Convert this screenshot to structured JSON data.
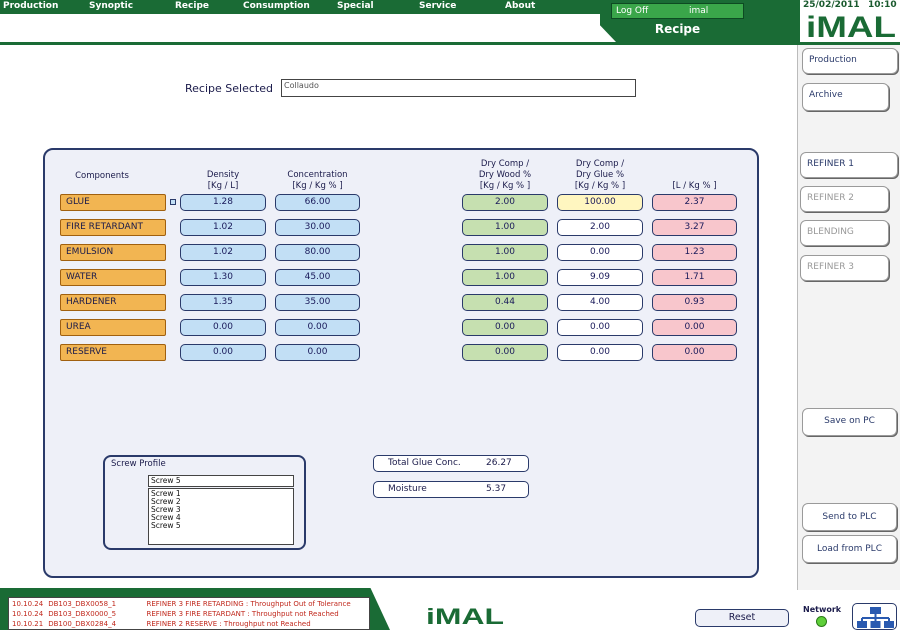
{
  "menu": [
    "Production",
    "Synoptic",
    "Recipe",
    "Consumption",
    "Special",
    "Service",
    "About"
  ],
  "header": {
    "logoff_label": "Log Off",
    "user": "imal",
    "date": "25/02/2011",
    "time": "10:10",
    "page_title": "Recipe",
    "logo_text": "iMAL"
  },
  "sidebar": {
    "top": [
      "Production",
      "Archive"
    ],
    "refiners": [
      "REFINER 1",
      "REFINER 2",
      "BLENDING",
      "REFINER 3"
    ],
    "save_pc": "Save on PC",
    "send_plc": "Send to PLC",
    "load_plc": "Load from PLC"
  },
  "recipe": {
    "label": "Recipe Selected",
    "value": "Collaudo"
  },
  "table": {
    "headers": {
      "components": "Components",
      "density": [
        "Density",
        "[Kg / L]"
      ],
      "concentration": [
        "Concentration",
        "[Kg / Kg % ]"
      ],
      "dry_wood": [
        "Dry Comp /",
        "Dry Wood %",
        "[Kg / Kg % ]"
      ],
      "dry_glue": [
        "Dry Comp /",
        "Dry Glue %",
        "[Kg / Kg % ]"
      ],
      "l_kg": [
        "[L / Kg % ]"
      ]
    },
    "rows": [
      {
        "name": "GLUE",
        "density": "1.28",
        "conc": "66.00",
        "dry_wood": "2.00",
        "dry_glue": "100.00",
        "l_kg": "2.37"
      },
      {
        "name": "FIRE RETARDANT",
        "density": "1.02",
        "conc": "30.00",
        "dry_wood": "1.00",
        "dry_glue": "2.00",
        "l_kg": "3.27"
      },
      {
        "name": "EMULSION",
        "density": "1.02",
        "conc": "80.00",
        "dry_wood": "1.00",
        "dry_glue": "0.00",
        "l_kg": "1.23"
      },
      {
        "name": "WATER",
        "density": "1.30",
        "conc": "45.00",
        "dry_wood": "1.00",
        "dry_glue": "9.09",
        "l_kg": "1.71"
      },
      {
        "name": "HARDENER",
        "density": "1.35",
        "conc": "35.00",
        "dry_wood": "0.44",
        "dry_glue": "4.00",
        "l_kg": "0.93"
      },
      {
        "name": "UREA",
        "density": "0.00",
        "conc": "0.00",
        "dry_wood": "0.00",
        "dry_glue": "0.00",
        "l_kg": "0.00"
      },
      {
        "name": "RESERVE",
        "density": "0.00",
        "conc": "0.00",
        "dry_wood": "0.00",
        "dry_glue": "0.00",
        "l_kg": "0.00"
      }
    ]
  },
  "screw": {
    "title": "Screw Profile",
    "selected": "Screw 5",
    "options": [
      "Screw 1",
      "Screw 2",
      "Screw 3",
      "Screw 4",
      "Screw 5"
    ]
  },
  "totals": {
    "glue_label": "Total Glue Conc.",
    "glue_value": "26.27",
    "moisture_label": "Moisture",
    "moisture_value": "5.37"
  },
  "alarms": [
    {
      "time": "10.10.24",
      "code": "DB103_DBX0058_1",
      "msg": "REFINER 3 FIRE RETARDING : Throughput Out of Tolerance"
    },
    {
      "time": "10.10.24",
      "code": "DB103_DBX0000_5",
      "msg": "REFINER 3 FIRE RETARDANT : Throughput not Reached"
    },
    {
      "time": "10.10.21",
      "code": "DB100_DBX0284_4",
      "msg": "REFINER 2 RESERVE : Throughput not Reached"
    }
  ],
  "footer": {
    "reset": "Reset",
    "network": "Network",
    "logo_text": "iMAL"
  }
}
